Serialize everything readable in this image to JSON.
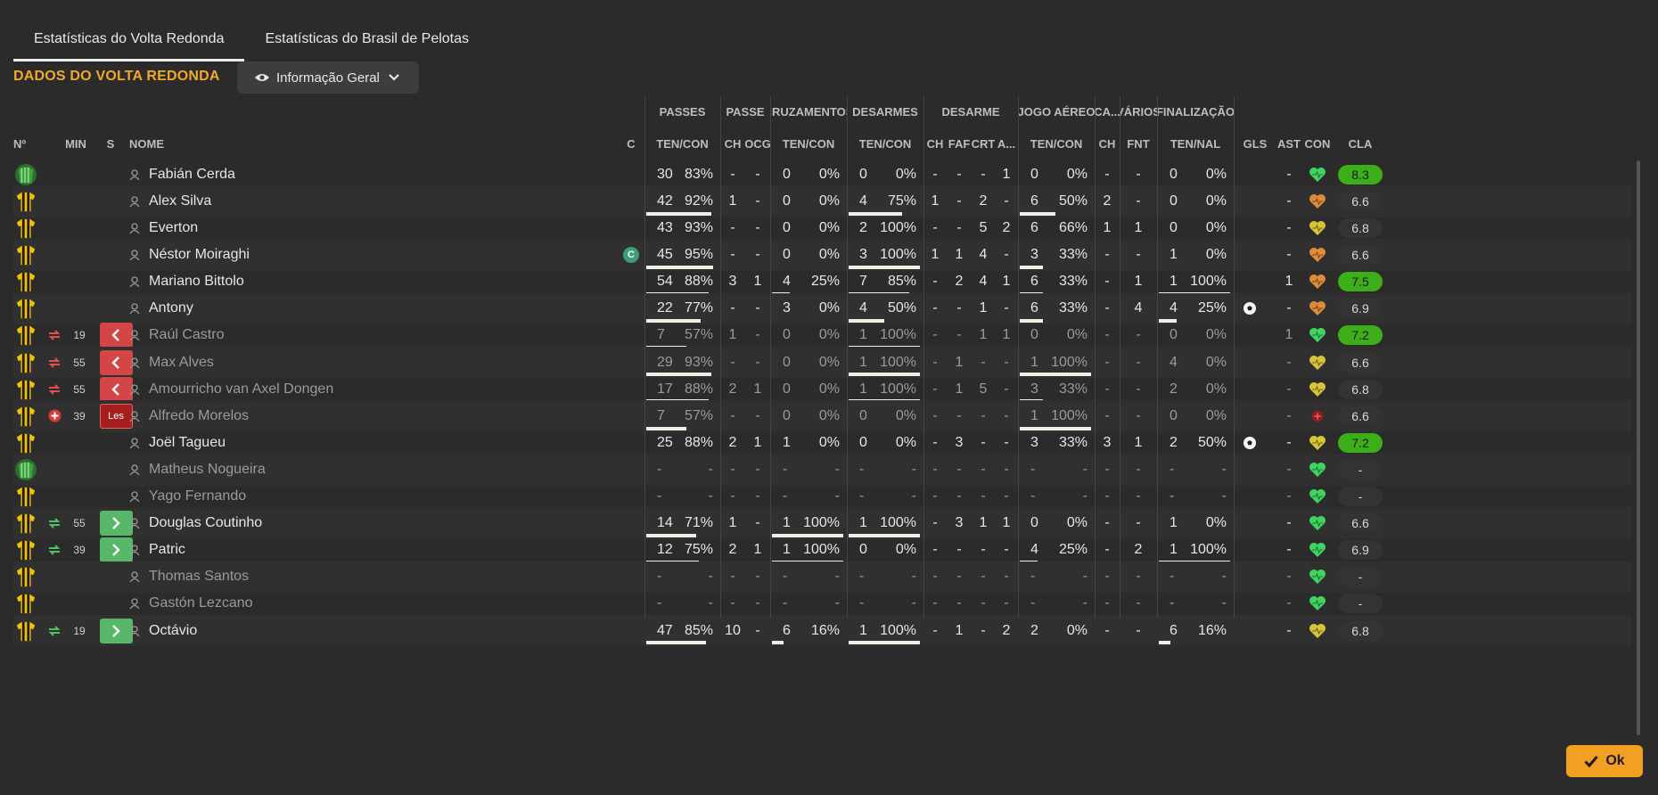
{
  "tabs": [
    {
      "label": "Estatísticas do Volta Redonda",
      "active": true
    },
    {
      "label": "Estatísticas do Brasil de Pelotas",
      "active": false
    }
  ],
  "section_title": "DADOS DO VOLTA REDONDA",
  "view_dropdown": {
    "label": "Informação Geral"
  },
  "group_headers": [
    "PASSES",
    "PASSE",
    "CRUZAMENTOS",
    "DESARMES",
    "DESARME",
    "JOGO AÉREO",
    "CA...",
    "VÁRIOS",
    "FINALIZAÇÃO"
  ],
  "column_headers": [
    "Nº",
    "MIN",
    "S",
    "NOME",
    "C",
    "TEN/CON",
    "CH",
    "OCG",
    "TEN/CON",
    "TEN/CON",
    "CH",
    "FAF",
    "CRT",
    "A...",
    "TEN/CON",
    "CH",
    "FNT",
    "TEN/NAL",
    "GLS",
    "AST",
    "CON",
    "CLA"
  ],
  "colors": {
    "accent": "#f2a829",
    "sub_off": "#d44646",
    "sub_on": "#58b86a",
    "rating_good": "#3cae1a",
    "captain": "#3e9e77"
  },
  "ok_label": "Ok",
  "players": [
    {
      "name": "Fabián Cerda",
      "kit": "gk",
      "min": "",
      "sub": "",
      "captain": false,
      "dim": false,
      "p": [
        "30",
        "83%",
        0.83
      ],
      "passe": [
        "-",
        "-"
      ],
      "cruz": [
        "0",
        "0%",
        0
      ],
      "des": [
        "0",
        "0%",
        0
      ],
      "desarme": [
        "-",
        "-",
        "-",
        "1"
      ],
      "aereo": [
        "0",
        "0%",
        0
      ],
      "ca": "-",
      "fnt": "-",
      "fin": [
        "0",
        "0%",
        0
      ],
      "gls": "",
      "ast": "-",
      "con": "heart-green",
      "cla": "8.3",
      "good": true
    },
    {
      "name": "Alex Silva",
      "kit": "field",
      "min": "",
      "sub": "",
      "captain": false,
      "dim": false,
      "p": [
        "42",
        "92%",
        0.92
      ],
      "passe": [
        "1",
        "-"
      ],
      "cruz": [
        "0",
        "0%",
        0
      ],
      "des": [
        "4",
        "75%",
        0.75
      ],
      "desarme": [
        "1",
        "-",
        "2",
        "-"
      ],
      "aereo": [
        "6",
        "50%",
        0.5
      ],
      "ca": "2",
      "fnt": "-",
      "fin": [
        "0",
        "0%",
        0
      ],
      "gls": "",
      "ast": "-",
      "con": "heart-orange",
      "cla": "6.6",
      "good": false
    },
    {
      "name": "Everton",
      "kit": "field",
      "min": "",
      "sub": "",
      "captain": false,
      "dim": false,
      "p": [
        "43",
        "93%",
        0.93
      ],
      "passe": [
        "-",
        "-"
      ],
      "cruz": [
        "0",
        "0%",
        0
      ],
      "des": [
        "2",
        "100%",
        1
      ],
      "desarme": [
        "-",
        "-",
        "5",
        "2"
      ],
      "aereo": [
        "6",
        "66%",
        0.66
      ],
      "ca": "1",
      "fnt": "1",
      "fin": [
        "0",
        "0%",
        0
      ],
      "gls": "",
      "ast": "-",
      "con": "heart-yellow",
      "cla": "6.8",
      "good": false
    },
    {
      "name": "Néstor Moiraghi",
      "kit": "field",
      "min": "",
      "sub": "",
      "captain": true,
      "dim": false,
      "p": [
        "45",
        "95%",
        0.95
      ],
      "passe": [
        "-",
        "-"
      ],
      "cruz": [
        "0",
        "0%",
        0
      ],
      "des": [
        "3",
        "100%",
        1
      ],
      "desarme": [
        "1",
        "1",
        "4",
        "-"
      ],
      "aereo": [
        "3",
        "33%",
        0.33
      ],
      "ca": "-",
      "fnt": "-",
      "fin": [
        "1",
        "0%",
        0
      ],
      "gls": "",
      "ast": "-",
      "con": "heart-orange",
      "cla": "6.6",
      "good": false
    },
    {
      "name": "Mariano Bittolo",
      "kit": "field",
      "min": "",
      "sub": "",
      "captain": false,
      "dim": false,
      "p": [
        "54",
        "88%",
        0.88
      ],
      "passe": [
        "3",
        "1"
      ],
      "cruz": [
        "4",
        "25%",
        0.25
      ],
      "des": [
        "7",
        "85%",
        0.85
      ],
      "desarme": [
        "-",
        "2",
        "4",
        "1"
      ],
      "aereo": [
        "6",
        "33%",
        0.33
      ],
      "ca": "-",
      "fnt": "1",
      "fin": [
        "1",
        "100%",
        1
      ],
      "gls": "",
      "ast": "1",
      "con": "heart-orange",
      "cla": "7.5",
      "good": true
    },
    {
      "name": "Antony",
      "kit": "field",
      "min": "",
      "sub": "",
      "captain": false,
      "dim": false,
      "p": [
        "22",
        "77%",
        0.77
      ],
      "passe": [
        "-",
        "-"
      ],
      "cruz": [
        "3",
        "0%",
        0
      ],
      "des": [
        "4",
        "50%",
        0.5
      ],
      "desarme": [
        "-",
        "-",
        "1",
        "-"
      ],
      "aereo": [
        "6",
        "33%",
        0.33
      ],
      "ca": "-",
      "fnt": "4",
      "fin": [
        "4",
        "25%",
        0.25
      ],
      "gls": "ball",
      "ast": "-",
      "con": "heart-orange",
      "cla": "6.9",
      "good": false
    },
    {
      "name": "Raúl Castro",
      "kit": "field",
      "min": "19",
      "sub": "off",
      "captain": false,
      "dim": true,
      "p": [
        "7",
        "57%",
        0.57
      ],
      "passe": [
        "1",
        "-"
      ],
      "cruz": [
        "0",
        "0%",
        0
      ],
      "des": [
        "1",
        "100%",
        1
      ],
      "desarme": [
        "-",
        "-",
        "1",
        "1"
      ],
      "aereo": [
        "0",
        "0%",
        0
      ],
      "ca": "-",
      "fnt": "-",
      "fin": [
        "0",
        "0%",
        0
      ],
      "gls": "",
      "ast": "1",
      "con": "heart-green",
      "cla": "7.2",
      "good": true
    },
    {
      "name": "Max Alves",
      "kit": "field",
      "min": "55",
      "sub": "off",
      "captain": false,
      "dim": true,
      "p": [
        "29",
        "93%",
        0.93
      ],
      "passe": [
        "-",
        "-"
      ],
      "cruz": [
        "0",
        "0%",
        0
      ],
      "des": [
        "1",
        "100%",
        1
      ],
      "desarme": [
        "-",
        "1",
        "-",
        "-"
      ],
      "aereo": [
        "1",
        "100%",
        1
      ],
      "ca": "-",
      "fnt": "-",
      "fin": [
        "4",
        "0%",
        0
      ],
      "gls": "",
      "ast": "-",
      "con": "heart-yellow",
      "cla": "6.6",
      "good": false
    },
    {
      "name": "Amourricho van Axel Dongen",
      "kit": "field",
      "min": "55",
      "sub": "off",
      "captain": false,
      "dim": true,
      "p": [
        "17",
        "88%",
        0.88
      ],
      "passe": [
        "2",
        "1"
      ],
      "cruz": [
        "0",
        "0%",
        0
      ],
      "des": [
        "1",
        "100%",
        1
      ],
      "desarme": [
        "-",
        "1",
        "5",
        "-"
      ],
      "aereo": [
        "3",
        "33%",
        0.33
      ],
      "ca": "-",
      "fnt": "-",
      "fin": [
        "2",
        "0%",
        0
      ],
      "gls": "",
      "ast": "-",
      "con": "heart-yellow",
      "cla": "6.8",
      "good": false
    },
    {
      "name": "Alfredo Morelos",
      "kit": "field",
      "min": "39",
      "sub": "injury",
      "captain": false,
      "dim": true,
      "p": [
        "7",
        "57%",
        0.57
      ],
      "passe": [
        "-",
        "-"
      ],
      "cruz": [
        "0",
        "0%",
        0
      ],
      "des": [
        "0",
        "0%",
        0
      ],
      "desarme": [
        "-",
        "-",
        "-",
        "-"
      ],
      "aereo": [
        "1",
        "100%",
        1
      ],
      "ca": "-",
      "fnt": "-",
      "fin": [
        "0",
        "0%",
        0
      ],
      "gls": "",
      "ast": "-",
      "con": "injury",
      "cla": "6.6",
      "good": false
    },
    {
      "name": "Joël Tagueu",
      "kit": "field",
      "min": "",
      "sub": "",
      "captain": false,
      "dim": false,
      "p": [
        "25",
        "88%",
        0.88
      ],
      "passe": [
        "2",
        "1"
      ],
      "cruz": [
        "1",
        "0%",
        0
      ],
      "des": [
        "0",
        "0%",
        0
      ],
      "desarme": [
        "-",
        "3",
        "-",
        "-"
      ],
      "aereo": [
        "3",
        "33%",
        0.33
      ],
      "ca": "3",
      "fnt": "1",
      "fin": [
        "2",
        "50%",
        0.5
      ],
      "gls": "ball",
      "ast": "-",
      "con": "heart-yellow",
      "cla": "7.2",
      "good": true
    },
    {
      "name": "Matheus Nogueira",
      "kit": "gk",
      "min": "",
      "sub": "",
      "captain": false,
      "dim": true,
      "p": [
        "-",
        "-",
        0
      ],
      "passe": [
        "-",
        "-"
      ],
      "cruz": [
        "-",
        "-",
        0
      ],
      "des": [
        "-",
        "-",
        0
      ],
      "desarme": [
        "-",
        "-",
        "-",
        "-"
      ],
      "aereo": [
        "-",
        "-",
        0
      ],
      "ca": "-",
      "fnt": "-",
      "fin": [
        "-",
        "-",
        0
      ],
      "gls": "",
      "ast": "-",
      "con": "heart-green",
      "cla": "-",
      "good": false
    },
    {
      "name": "Yago Fernando",
      "kit": "field",
      "min": "",
      "sub": "",
      "captain": false,
      "dim": true,
      "p": [
        "-",
        "-",
        0
      ],
      "passe": [
        "-",
        "-"
      ],
      "cruz": [
        "-",
        "-",
        0
      ],
      "des": [
        "-",
        "-",
        0
      ],
      "desarme": [
        "-",
        "-",
        "-",
        "-"
      ],
      "aereo": [
        "-",
        "-",
        0
      ],
      "ca": "-",
      "fnt": "-",
      "fin": [
        "-",
        "-",
        0
      ],
      "gls": "",
      "ast": "-",
      "con": "heart-green",
      "cla": "-",
      "good": false
    },
    {
      "name": "Douglas Coutinho",
      "kit": "field",
      "min": "55",
      "sub": "on",
      "captain": false,
      "dim": false,
      "p": [
        "14",
        "71%",
        0.71
      ],
      "passe": [
        "1",
        "-"
      ],
      "cruz": [
        "1",
        "100%",
        1
      ],
      "des": [
        "1",
        "100%",
        1
      ],
      "desarme": [
        "-",
        "3",
        "1",
        "1"
      ],
      "aereo": [
        "0",
        "0%",
        0
      ],
      "ca": "-",
      "fnt": "-",
      "fin": [
        "1",
        "0%",
        0
      ],
      "gls": "",
      "ast": "-",
      "con": "heart-green",
      "cla": "6.6",
      "good": false
    },
    {
      "name": "Patric",
      "kit": "field",
      "min": "39",
      "sub": "on",
      "captain": false,
      "dim": false,
      "p": [
        "12",
        "75%",
        0.75
      ],
      "passe": [
        "2",
        "1"
      ],
      "cruz": [
        "1",
        "100%",
        1
      ],
      "des": [
        "0",
        "0%",
        0
      ],
      "desarme": [
        "-",
        "-",
        "-",
        "-"
      ],
      "aereo": [
        "4",
        "25%",
        0.25
      ],
      "ca": "-",
      "fnt": "2",
      "fin": [
        "1",
        "100%",
        1
      ],
      "gls": "",
      "ast": "-",
      "con": "heart-green",
      "cla": "6.9",
      "good": false
    },
    {
      "name": "Thomas Santos",
      "kit": "field",
      "min": "",
      "sub": "",
      "captain": false,
      "dim": true,
      "p": [
        "-",
        "-",
        0
      ],
      "passe": [
        "-",
        "-"
      ],
      "cruz": [
        "-",
        "-",
        0
      ],
      "des": [
        "-",
        "-",
        0
      ],
      "desarme": [
        "-",
        "-",
        "-",
        "-"
      ],
      "aereo": [
        "-",
        "-",
        0
      ],
      "ca": "-",
      "fnt": "-",
      "fin": [
        "-",
        "-",
        0
      ],
      "gls": "",
      "ast": "-",
      "con": "heart-green",
      "cla": "-",
      "good": false
    },
    {
      "name": "Gastón Lezcano",
      "kit": "field",
      "min": "",
      "sub": "",
      "captain": false,
      "dim": true,
      "p": [
        "-",
        "-",
        0
      ],
      "passe": [
        "-",
        "-"
      ],
      "cruz": [
        "-",
        "-",
        0
      ],
      "des": [
        "-",
        "-",
        0
      ],
      "desarme": [
        "-",
        "-",
        "-",
        "-"
      ],
      "aereo": [
        "-",
        "-",
        0
      ],
      "ca": "-",
      "fnt": "-",
      "fin": [
        "-",
        "-",
        0
      ],
      "gls": "",
      "ast": "-",
      "con": "heart-green",
      "cla": "-",
      "good": false
    },
    {
      "name": "Octávio",
      "kit": "field",
      "min": "19",
      "sub": "on",
      "captain": false,
      "dim": false,
      "p": [
        "47",
        "85%",
        0.85
      ],
      "passe": [
        "10",
        "-"
      ],
      "cruz": [
        "6",
        "16%",
        0.16
      ],
      "des": [
        "1",
        "100%",
        1
      ],
      "desarme": [
        "-",
        "1",
        "-",
        "2"
      ],
      "aereo": [
        "2",
        "0%",
        0
      ],
      "ca": "-",
      "fnt": "-",
      "fin": [
        "6",
        "16%",
        0.16
      ],
      "gls": "",
      "ast": "-",
      "con": "heart-yellow",
      "cla": "6.8",
      "good": false
    }
  ]
}
